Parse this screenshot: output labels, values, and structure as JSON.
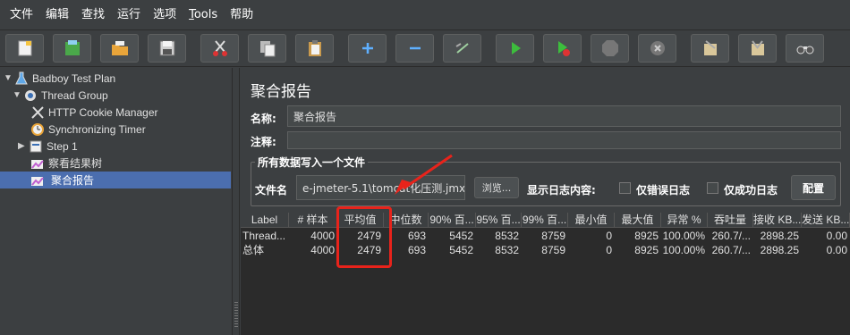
{
  "menu": [
    "文件",
    "编辑",
    "查找",
    "运行",
    "选项",
    "Tools",
    "帮助"
  ],
  "toolbar": {
    "buttons": [
      "new-icon",
      "templates-icon",
      "open-icon",
      "save-icon",
      "cut-icon",
      "copy-icon",
      "paste-icon",
      "expand-icon",
      "collapse-icon",
      "toggle-icon",
      "start-icon",
      "start-no-pauses-icon",
      "stop-icon",
      "shutdown-icon",
      "clear-icon",
      "clear-all-icon",
      "search-icon"
    ]
  },
  "tree": {
    "items": [
      {
        "label": "Badboy Test Plan",
        "icon": "test-plan-icon"
      },
      {
        "label": "Thread Group",
        "icon": "gear-icon"
      },
      {
        "label": "HTTP Cookie Manager",
        "icon": "tools-icon"
      },
      {
        "label": "Synchronizing Timer",
        "icon": "timer-icon"
      },
      {
        "label": "Step 1",
        "icon": "step-icon"
      },
      {
        "label": "察看结果树",
        "icon": "listener-icon"
      },
      {
        "label": "聚合报告",
        "icon": "listener-icon"
      }
    ]
  },
  "panel": {
    "title": "聚合报告",
    "name_label": "名称:",
    "name_value": "聚合报告",
    "comment_label": "注释:",
    "comment_value": "",
    "file_group_title": "所有数据写入一个文件",
    "filename_label": "文件名",
    "filename_value": "e-jmeter-5.1\\tomcat化压测.jmx",
    "browse_label": "浏览...",
    "log_content_label": "显示日志内容:",
    "errors_only_label": "仅错误日志",
    "success_only_label": "仅成功日志",
    "configure_label": "配置"
  },
  "table": {
    "headers": [
      "Label",
      "# 样本",
      "平均值",
      "中位数",
      "90% 百...",
      "95% 百...",
      "99% 百...",
      "最小值",
      "最大值",
      "异常 %",
      "吞吐量",
      "接收 KB...",
      "发送 KB..."
    ],
    "rows": [
      [
        "Thread...",
        "4000",
        "2479",
        "693",
        "5452",
        "8532",
        "8759",
        "0",
        "8925",
        "100.00%",
        "260.7/...",
        "2898.25",
        "0.00"
      ],
      [
        "总体",
        "4000",
        "2479",
        "693",
        "5452",
        "8532",
        "8759",
        "0",
        "8925",
        "100.00%",
        "260.7/...",
        "2898.25",
        "0.00"
      ]
    ]
  },
  "colors": {
    "background": "#3c3f41",
    "table_background": "#2b2b2b",
    "selection": "#4b6eaf",
    "annotation": "#e8231b"
  }
}
